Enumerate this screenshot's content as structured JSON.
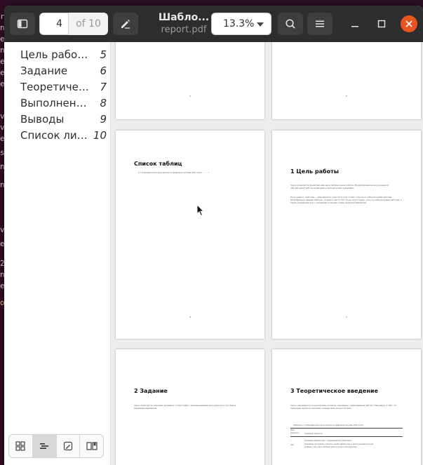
{
  "terminal_strip": [
    "r",
    "n",
    "e",
    "n",
    "e",
    "e",
    "e",
    "v",
    "v",
    "e",
    "s",
    "n",
    "n",
    "v",
    "e",
    "2",
    "n",
    "e",
    "o"
  ],
  "header": {
    "page_number": "4",
    "page_of": "of 10",
    "title": "Шабло...",
    "subtitle": "report.pdf",
    "zoom": "13.3%"
  },
  "toc": [
    {
      "label": "Цель работы",
      "page": "5"
    },
    {
      "label": "Задание",
      "page": "6"
    },
    {
      "label": "Теоретическ...",
      "page": "7"
    },
    {
      "label": "Выполнени...",
      "page": "8"
    },
    {
      "label": "Выводы",
      "page": "9"
    },
    {
      "label": "Список лит...",
      "page": "10"
    }
  ],
  "pages": {
    "p2": {
      "num": "2"
    },
    "p3": {
      "num": "3"
    },
    "p4": {
      "heading": "Список таблиц",
      "entry": "3.1 Описание некоторых каталогов файловой системы GNU Linux . . . . . 7",
      "num": "4"
    },
    "p5": {
      "heading": "1 Цель работы",
      "body1": "Здесь приводится формулировка цели лабораторной работы. Формулировки цели для каждой лабораторной работы приведены в методических указаниях.",
      "body2": "Цель данного шаблона — максимально упростить подготовку отчетов по лабораторным работам. Модифицируя данный шаблон, студенты смогут без труда подготовить отчет по лабораторным работам, а также познакомиться с основными возможностями разметки Markdown.",
      "num": "5"
    },
    "p6": {
      "heading": "2 Задание",
      "body": "Здесь приводится описание задания в соответствии с рекомендациями методического пособия и выданным вариантом."
    },
    "p7": {
      "heading": "3 Теоретическое введение",
      "body": "Здесь описываются теоретические аспекты, связанные с выполнением работы. Например, в табл. 3.1 приведено краткое описание стандартных каталогов Unix.",
      "table_caption": "Таблица 3.1: Описание некоторых каталогов файловой системы GNU Linux",
      "col1": "Имя каталога",
      "col2": "Описание каталога",
      "row1_name": "/",
      "row1_desc": "Корневая директория, содержащая всю файловую",
      "row2_name": "/bin",
      "row2_desc": "Основные системные утилиты, необходимые как в однопользовательском режиме, так и при обычной работе всем пользователям"
    }
  }
}
